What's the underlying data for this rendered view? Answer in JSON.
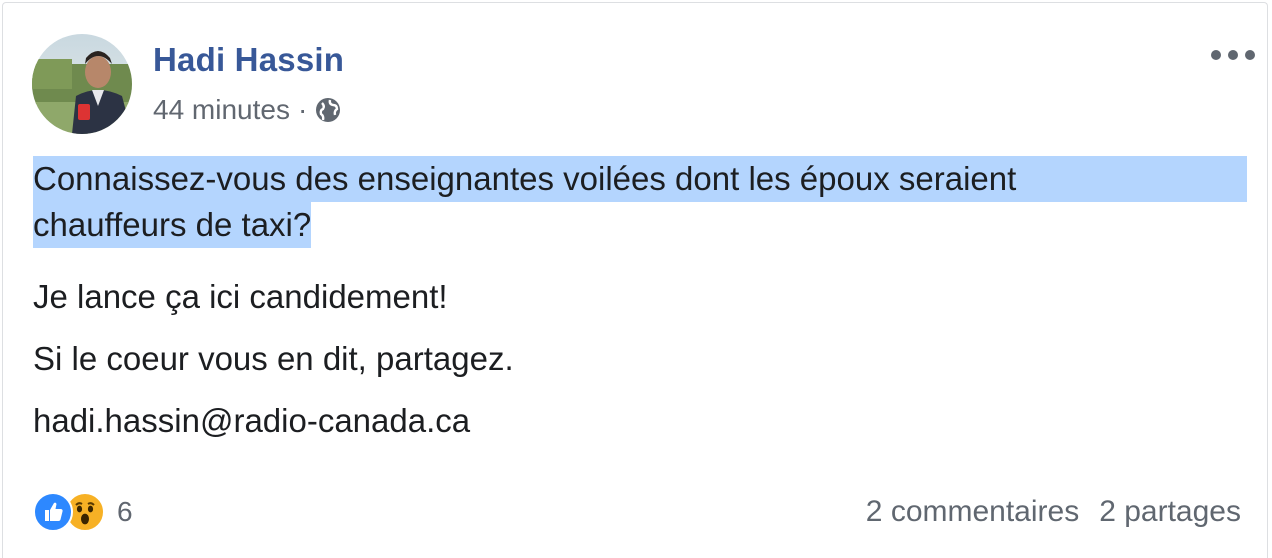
{
  "post": {
    "author": "Hadi Hassin",
    "timestamp": "44 minutes",
    "separator": "·",
    "privacy_icon": "globe-icon",
    "more_icon": "more-options-icon",
    "paragraphs": {
      "p1_line1": "Connaissez-vous des enseignantes voilées dont les époux seraient",
      "p1_line2": "chauffeurs de taxi?",
      "p2": "Je lance ça ici candidement!",
      "p3": "Si le coeur vous en dit, partagez.",
      "p4": "hadi.hassin@radio-canada.ca"
    },
    "highlight_color": "#b4d5fe",
    "author_color": "#385898"
  },
  "footer": {
    "reaction_icons": [
      "like-icon",
      "wow-icon"
    ],
    "reaction_count": "6",
    "comments": "2 commentaires",
    "shares": "2 partages"
  }
}
